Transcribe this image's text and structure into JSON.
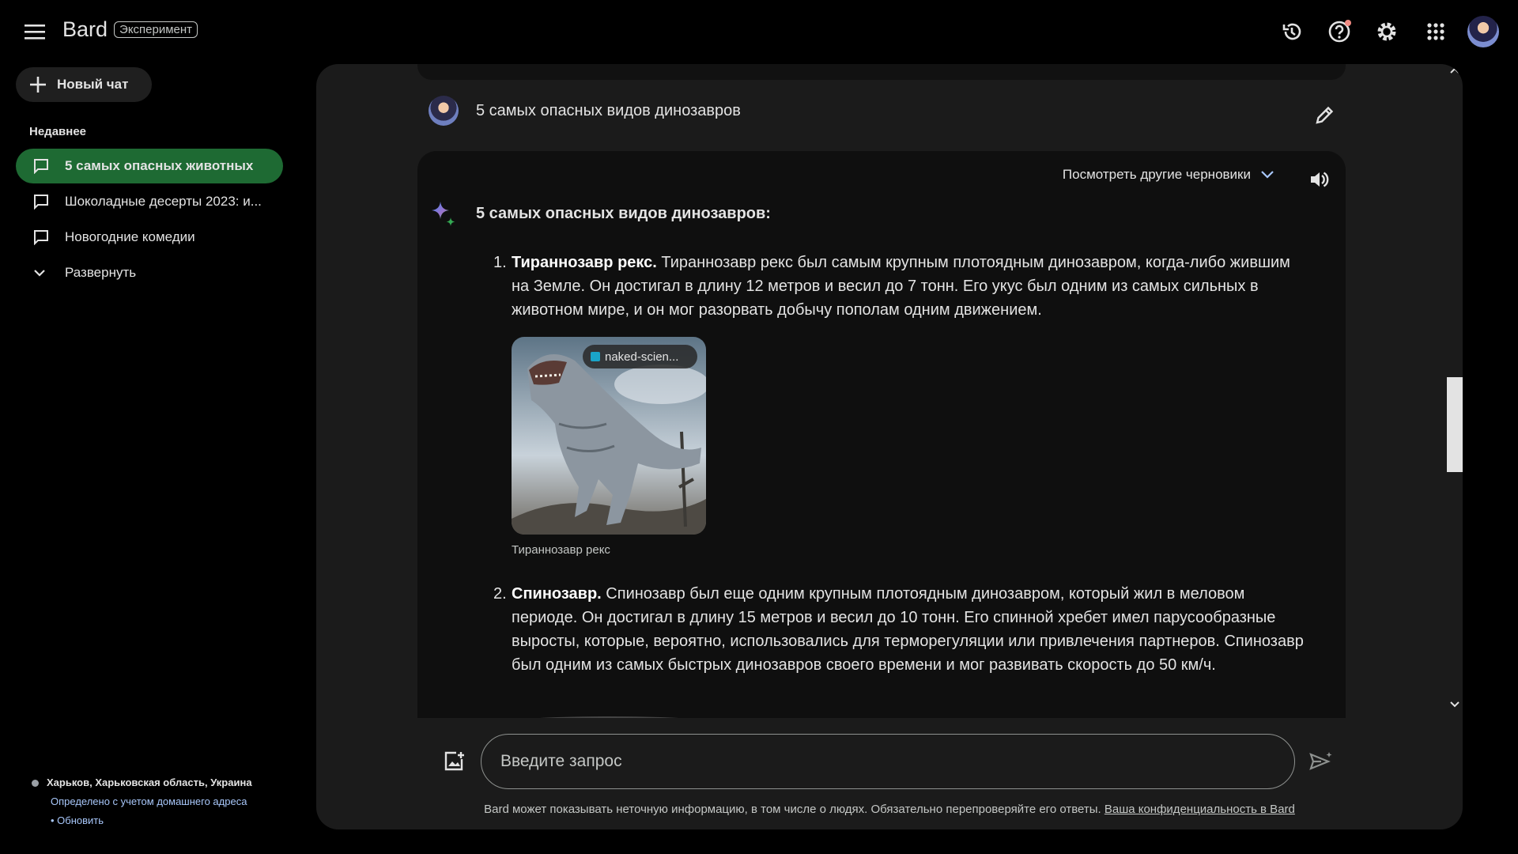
{
  "header": {
    "brand": "Bard",
    "badge": "Эксперимент"
  },
  "sidebar": {
    "new_chat": "Новый чат",
    "recent_label": "Недавнее",
    "items": [
      {
        "label": "5 самых опасных животных",
        "active": true
      },
      {
        "label": "Шоколадные десерты 2023: и...",
        "active": false
      },
      {
        "label": "Новогодние комедии",
        "active": false
      }
    ],
    "expand": "Развернуть",
    "location": {
      "place": "Харьков, Харьковская область, Украина",
      "source": "Определено с учетом домашнего адреса",
      "update_prefix": "• ",
      "update": "Обновить"
    }
  },
  "chat": {
    "query": "5 самых опасных видов динозавров",
    "drafts": "Посмотреть другие черновики",
    "response_title": "5 самых опасных видов динозавров:",
    "items": [
      {
        "num": "1.",
        "name": "Тираннозавр рекс.",
        "text": " Тираннозавр рекс был самым крупным плотоядным динозавром, когда-либо жившим на Земле. Он достигал в длину 12 метров и весил до 7 тонн. Его укус был одним из самых сильных в животном мире, и он мог разорвать добычу пополам одним движением."
      },
      {
        "num": "2.",
        "name": "Спинозавр.",
        "text": " Спинозавр был еще одним крупным плотоядным динозавром, который жил в меловом периоде. Он достигал в длину 15 метров и весил до 10 тонн. Его спинной хребет имел парусообразные выросты, которые, вероятно, использовались для терморегуляции или привлечения партнеров. Спинозавр был одним из самых быстрых динозавров своего времени и мог развивать скорость до 50 км/ч."
      }
    ],
    "image": {
      "source": "naked-scien...",
      "caption": "Тираннозавр рекс"
    }
  },
  "input": {
    "placeholder": "Введите запрос",
    "disclaimer": "Bard может показывать неточную информацию, в том числе о людях. Обязательно перепроверяйте его ответы. ",
    "privacy_link": "Ваша конфиденциальность в Bard"
  },
  "colors": {
    "active_item": "#1e6a33",
    "panel": "#1b1b1b",
    "card": "#0f0f0f",
    "link": "#a8c7fa",
    "notification_dot": "#f28b82"
  }
}
